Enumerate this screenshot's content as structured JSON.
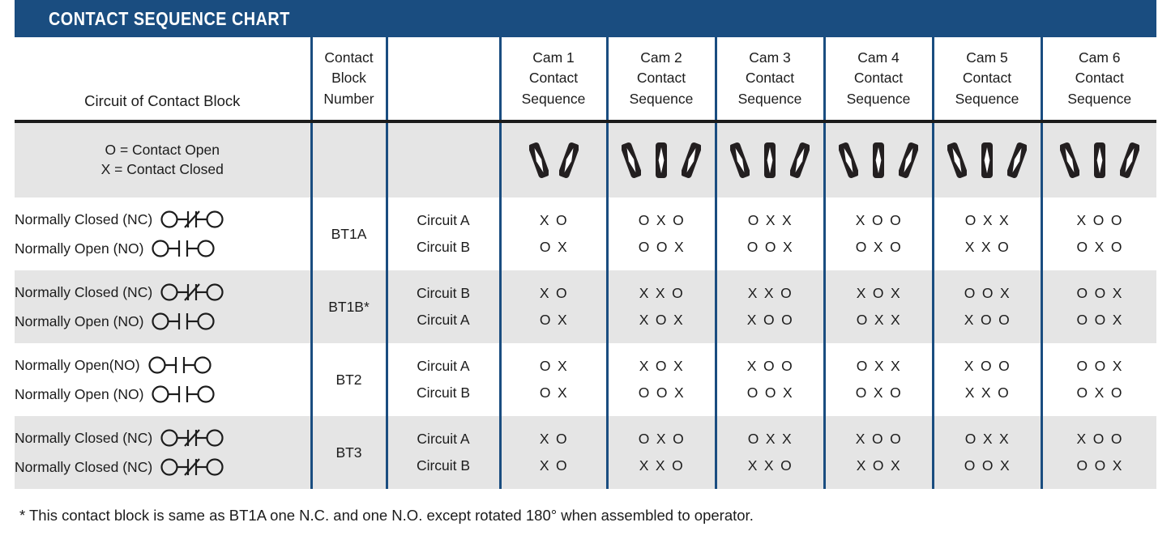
{
  "header": {
    "title": "CONTACT SEQUENCE CHART",
    "bar_color": "#1a4d80"
  },
  "columns": {
    "circuit_of_contact_block": "Circuit of Contact Block",
    "contact_block_number": "Contact\nBlock\nNumber",
    "contact_block_number_lines": [
      "Contact",
      "Block",
      "Number"
    ],
    "circuit_col": "",
    "cams": [
      {
        "name": "Cam 1",
        "line2": "Contact",
        "line3": "Sequence",
        "symbol_count": 2
      },
      {
        "name": "Cam 2",
        "line2": "Contact",
        "line3": "Sequence",
        "symbol_count": 3
      },
      {
        "name": "Cam 3",
        "line2": "Contact",
        "line3": "Sequence",
        "symbol_count": 3
      },
      {
        "name": "Cam 4",
        "line2": "Contact",
        "line3": "Sequence",
        "symbol_count": 3
      },
      {
        "name": "Cam 5",
        "line2": "Contact",
        "line3": "Sequence",
        "symbol_count": 3
      },
      {
        "name": "Cam 6",
        "line2": "Contact",
        "line3": "Sequence",
        "symbol_count": 3
      }
    ]
  },
  "legend": {
    "line1": "O = Contact Open",
    "line2": "X = Contact Closed"
  },
  "chart_data": {
    "type": "table",
    "title": "CONTACT SEQUENCE CHART",
    "row_groups": [
      {
        "block_number": "BT1A",
        "shaded": false,
        "rows": [
          {
            "description": "Normally Closed (NC)",
            "symbol": "nc",
            "circuit": "Circuit A",
            "sequences": [
              "X O",
              "O X O",
              "O X X",
              "X O O",
              "O X X",
              "X O O"
            ]
          },
          {
            "description": "Normally Open (NO)",
            "symbol": "no",
            "circuit": "Circuit B",
            "sequences": [
              "O X",
              "O O X",
              "O O X",
              "O X O",
              "X X O",
              "O X O"
            ]
          }
        ]
      },
      {
        "block_number": "BT1B*",
        "shaded": true,
        "rows": [
          {
            "description": "Normally Closed (NC)",
            "symbol": "nc",
            "circuit": "Circuit B",
            "sequences": [
              "X O",
              "X X O",
              "X X O",
              "X O X",
              "O O X",
              "O O X"
            ]
          },
          {
            "description": "Normally Open (NO)",
            "symbol": "no",
            "circuit": "Circuit A",
            "sequences": [
              "O X",
              "X O X",
              "X O O",
              "O X X",
              "X O O",
              "O O X"
            ]
          }
        ]
      },
      {
        "block_number": "BT2",
        "shaded": false,
        "rows": [
          {
            "description": "Normally Open(NO)",
            "symbol": "no",
            "circuit": "Circuit A",
            "sequences": [
              "O X",
              "X O X",
              "X O O",
              "O X X",
              "X O O",
              "O O X"
            ]
          },
          {
            "description": "Normally Open (NO)",
            "symbol": "no",
            "circuit": "Circuit B",
            "sequences": [
              "O X",
              "O O X",
              "O O X",
              "O X O",
              "X X O",
              "O X O"
            ]
          }
        ]
      },
      {
        "block_number": "BT3",
        "shaded": true,
        "rows": [
          {
            "description": "Normally Closed (NC)",
            "symbol": "nc",
            "circuit": "Circuit A",
            "sequences": [
              "X O",
              "O X O",
              "O X X",
              "X O O",
              "O X X",
              "X O O"
            ]
          },
          {
            "description": "Normally Closed (NC)",
            "symbol": "nc",
            "circuit": "Circuit B",
            "sequences": [
              "X O",
              "X X O",
              "X X O",
              "X O X",
              "O O X",
              "O O X"
            ]
          }
        ]
      }
    ],
    "legend": {
      "O": "Contact Open",
      "X": "Contact Closed"
    },
    "cam_columns": [
      "Cam 1",
      "Cam 2",
      "Cam 3",
      "Cam 4",
      "Cam 5",
      "Cam 6"
    ]
  },
  "footnote": "* This contact block is same as BT1A one N.C. and one N.O. except rotated 180° when assembled to operator.",
  "colors": {
    "navy": "#1a4d80",
    "shade": "#e5e5e5",
    "rule": "#1b1b1b",
    "text": "#1c1c1c"
  }
}
